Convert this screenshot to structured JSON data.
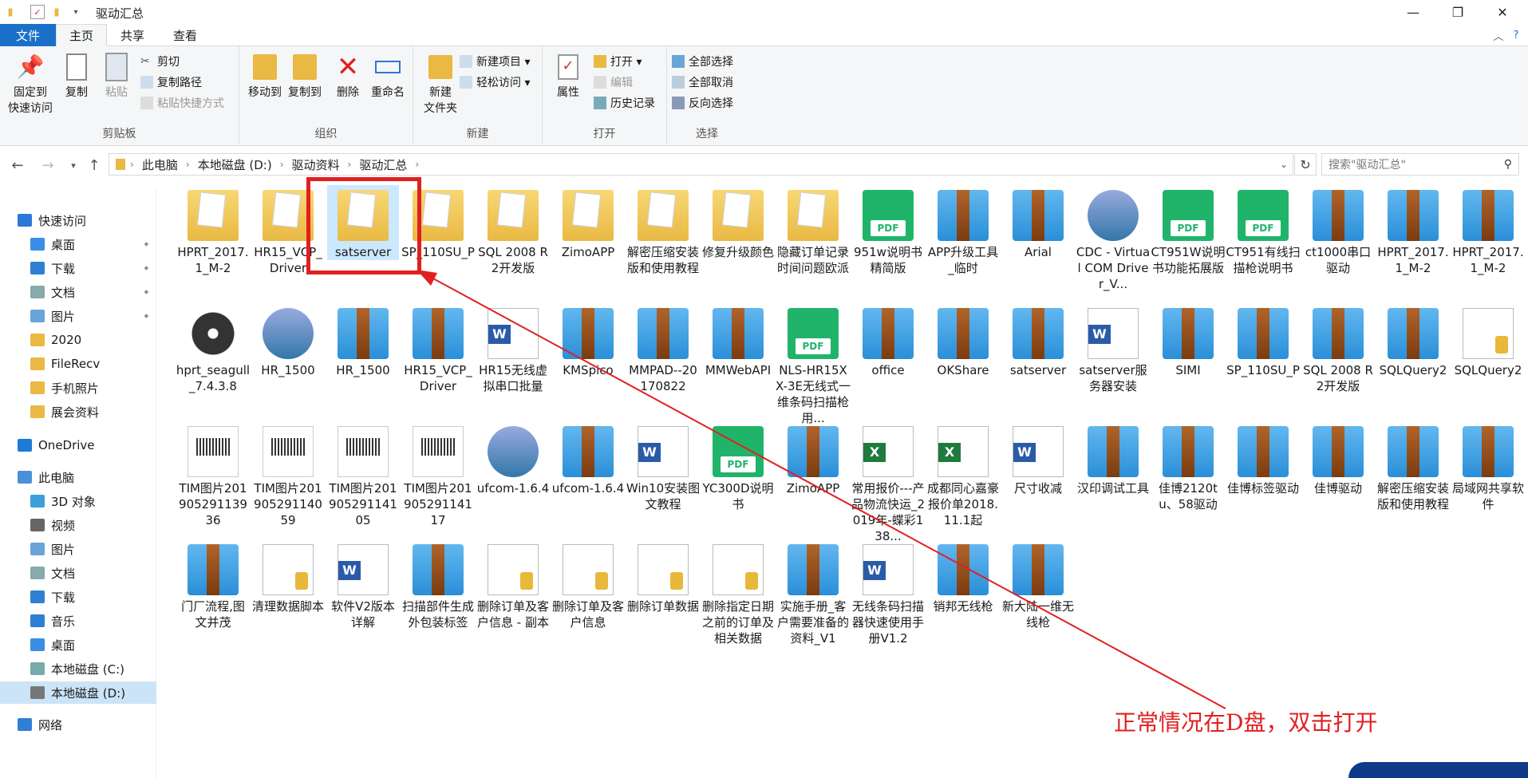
{
  "window": {
    "title": "驱动汇总"
  },
  "tabs": [
    "文件",
    "主页",
    "共享",
    "查看"
  ],
  "ribbon": {
    "clipboard": {
      "label": "剪贴板",
      "pin": "固定到\n快速访问",
      "copy": "复制",
      "paste": "粘贴",
      "cut": "剪切",
      "copy_path": "复制路径",
      "paste_shortcut": "粘贴快捷方式"
    },
    "organize": {
      "label": "组织",
      "move_to": "移动到",
      "copy_to": "复制到",
      "delete": "删除",
      "rename": "重命名"
    },
    "new": {
      "label": "新建",
      "new_folder": "新建\n文件夹",
      "new_item": "新建项目 ▾",
      "easy_access": "轻松访问 ▾"
    },
    "open": {
      "label": "打开",
      "properties": "属性",
      "open": "打开 ▾",
      "edit": "编辑",
      "history": "历史记录"
    },
    "select": {
      "label": "选择",
      "select_all": "全部选择",
      "select_none": "全部取消",
      "invert": "反向选择"
    }
  },
  "address": {
    "crumbs": [
      "此电脑",
      "本地磁盘 (D:)",
      "驱动资料",
      "驱动汇总"
    ],
    "search_placeholder": "搜索\"驱动汇总\""
  },
  "nav": [
    {
      "label": "快速访问",
      "icon": "star-icon",
      "color": "#2b78d6"
    },
    {
      "label": "桌面",
      "icon": "desktop-icon",
      "color": "#3a8ee6",
      "pin": true
    },
    {
      "label": "下载",
      "icon": "download-icon",
      "color": "#2f7fd4",
      "pin": true
    },
    {
      "label": "文档",
      "icon": "document-icon",
      "color": "#8aa",
      "pin": true
    },
    {
      "label": "图片",
      "icon": "pictures-icon",
      "color": "#6aa4d8",
      "pin": true
    },
    {
      "label": "2020",
      "icon": "folder-icon",
      "color": "#e9b943"
    },
    {
      "label": "FileRecv",
      "icon": "folder-icon",
      "color": "#e9b943"
    },
    {
      "label": "手机照片",
      "icon": "folder-icon",
      "color": "#e9b943"
    },
    {
      "label": "展会资料",
      "icon": "folder-icon",
      "color": "#e9b943"
    },
    {
      "label": "OneDrive",
      "icon": "cloud-icon",
      "color": "#1c7bd4"
    },
    {
      "label": "此电脑",
      "icon": "computer-icon",
      "color": "#4a90d9"
    },
    {
      "label": "3D 对象",
      "icon": "cube-icon",
      "color": "#3aa0d8"
    },
    {
      "label": "视频",
      "icon": "video-icon",
      "color": "#666"
    },
    {
      "label": "图片",
      "icon": "pictures-icon",
      "color": "#6aa4d8"
    },
    {
      "label": "文档",
      "icon": "document-icon",
      "color": "#8aa"
    },
    {
      "label": "下载",
      "icon": "download-icon",
      "color": "#2f7fd4"
    },
    {
      "label": "音乐",
      "icon": "music-icon",
      "color": "#2f7fd4"
    },
    {
      "label": "桌面",
      "icon": "desktop-icon",
      "color": "#3a8ee6"
    },
    {
      "label": "本地磁盘 (C:)",
      "icon": "drive-icon",
      "color": "#7aa"
    },
    {
      "label": "本地磁盘 (D:)",
      "icon": "drive-icon",
      "color": "#777",
      "selected": true
    },
    {
      "label": "网络",
      "icon": "network-icon",
      "color": "#2f7fd4"
    }
  ],
  "files": [
    {
      "name": "HPRT_2017.1_M-2",
      "type": "folder"
    },
    {
      "name": "HR15_VCP_Driver",
      "type": "folder"
    },
    {
      "name": "satserver",
      "type": "folder",
      "selected": true
    },
    {
      "name": "SP_110SU_P",
      "type": "folder"
    },
    {
      "name": "SQL 2008 R2开发版",
      "type": "folder"
    },
    {
      "name": "ZimoAPP",
      "type": "folder"
    },
    {
      "name": "解密压缩安装版和使用教程",
      "type": "folder"
    },
    {
      "name": "修复升级颜色",
      "type": "folder"
    },
    {
      "name": "隐藏订单记录时间问题欧派",
      "type": "folder"
    },
    {
      "name": "951w说明书精简版",
      "type": "pdf"
    },
    {
      "name": "APP升级工具_临时",
      "type": "zip"
    },
    {
      "name": "Arial",
      "type": "zip"
    },
    {
      "name": "CDC - Virtual COM Driver_V...",
      "type": "setup"
    },
    {
      "name": "CT951W说明书功能拓展版",
      "type": "pdf"
    },
    {
      "name": "CT951有线扫描枪说明书",
      "type": "pdf"
    },
    {
      "name": "ct1000串口驱动",
      "type": "zip"
    },
    {
      "name": "HPRT_2017.1_M-2",
      "type": "zip"
    },
    {
      "name": "HPRT_2017.1_M-2",
      "type": "zip"
    },
    {
      "name": "hprt_seagull_7.4.3.8",
      "type": "disc"
    },
    {
      "name": "HR_1500",
      "type": "setup"
    },
    {
      "name": "HR_1500",
      "type": "zip"
    },
    {
      "name": "HR15_VCP_Driver",
      "type": "zip"
    },
    {
      "name": "HR15无线虚拟串口批量",
      "type": "word"
    },
    {
      "name": "KMSpico",
      "type": "zip"
    },
    {
      "name": "MMPAD--20170822",
      "type": "zip"
    },
    {
      "name": "MMWebAPI",
      "type": "zip"
    },
    {
      "name": "NLS-HR15XX-3E无线式一维条码扫描枪用...",
      "type": "pdf"
    },
    {
      "name": "office",
      "type": "zip"
    },
    {
      "name": "OKShare",
      "type": "zip"
    },
    {
      "name": "satserver",
      "type": "zip"
    },
    {
      "name": "satserver服务器安装",
      "type": "word"
    },
    {
      "name": "SIMI",
      "type": "zip"
    },
    {
      "name": "SP_110SU_P",
      "type": "zip"
    },
    {
      "name": "SQL 2008 R2开发版",
      "type": "zip"
    },
    {
      "name": "SQLQuery2",
      "type": "zip"
    },
    {
      "name": "SQLQuery2",
      "type": "doc"
    },
    {
      "name": "TIM图片20190529113936",
      "type": "img"
    },
    {
      "name": "TIM图片20190529114059",
      "type": "img"
    },
    {
      "name": "TIM图片20190529114105",
      "type": "img"
    },
    {
      "name": "TIM图片20190529114117",
      "type": "img"
    },
    {
      "name": "ufcom-1.6.4",
      "type": "setup"
    },
    {
      "name": "ufcom-1.6.4",
      "type": "zip"
    },
    {
      "name": "Win10安装图文教程",
      "type": "word"
    },
    {
      "name": "YC300D说明书",
      "type": "pdf"
    },
    {
      "name": "ZimoAPP",
      "type": "zip"
    },
    {
      "name": "常用报价---产品物流快运_2019年-蝶彩138...",
      "type": "excel"
    },
    {
      "name": "成都同心嘉豪报价单2018.11.1起",
      "type": "excel"
    },
    {
      "name": "尺寸收减",
      "type": "word"
    },
    {
      "name": "汉印调试工具",
      "type": "zip"
    },
    {
      "name": "佳博2120tu、58驱动",
      "type": "zip"
    },
    {
      "name": "佳博标签驱动",
      "type": "zip"
    },
    {
      "name": "佳博驱动",
      "type": "zip"
    },
    {
      "name": "解密压缩安装版和使用教程",
      "type": "zip"
    },
    {
      "name": "局域网共享软件",
      "type": "zip"
    },
    {
      "name": "门厂流程,图文并茂",
      "type": "zip"
    },
    {
      "name": "清理数据脚本",
      "type": "doc"
    },
    {
      "name": "软件V2版本详解",
      "type": "word"
    },
    {
      "name": "扫描部件生成外包装标签",
      "type": "zip"
    },
    {
      "name": "删除订单及客户信息 - 副本",
      "type": "doc"
    },
    {
      "name": "删除订单及客户信息",
      "type": "doc"
    },
    {
      "name": "删除订单数据",
      "type": "doc"
    },
    {
      "name": "删除指定日期之前的订单及相关数据",
      "type": "doc"
    },
    {
      "name": "实施手册_客户需要准备的资料_V1",
      "type": "zip"
    },
    {
      "name": "无线条码扫描器快速使用手册V1.2",
      "type": "word"
    },
    {
      "name": "销邦无线枪",
      "type": "zip"
    },
    {
      "name": "新大陆一维无线枪",
      "type": "zip"
    }
  ],
  "annotation": {
    "text": "正常情况在D盘，双击打开",
    "color": "#e02020"
  }
}
